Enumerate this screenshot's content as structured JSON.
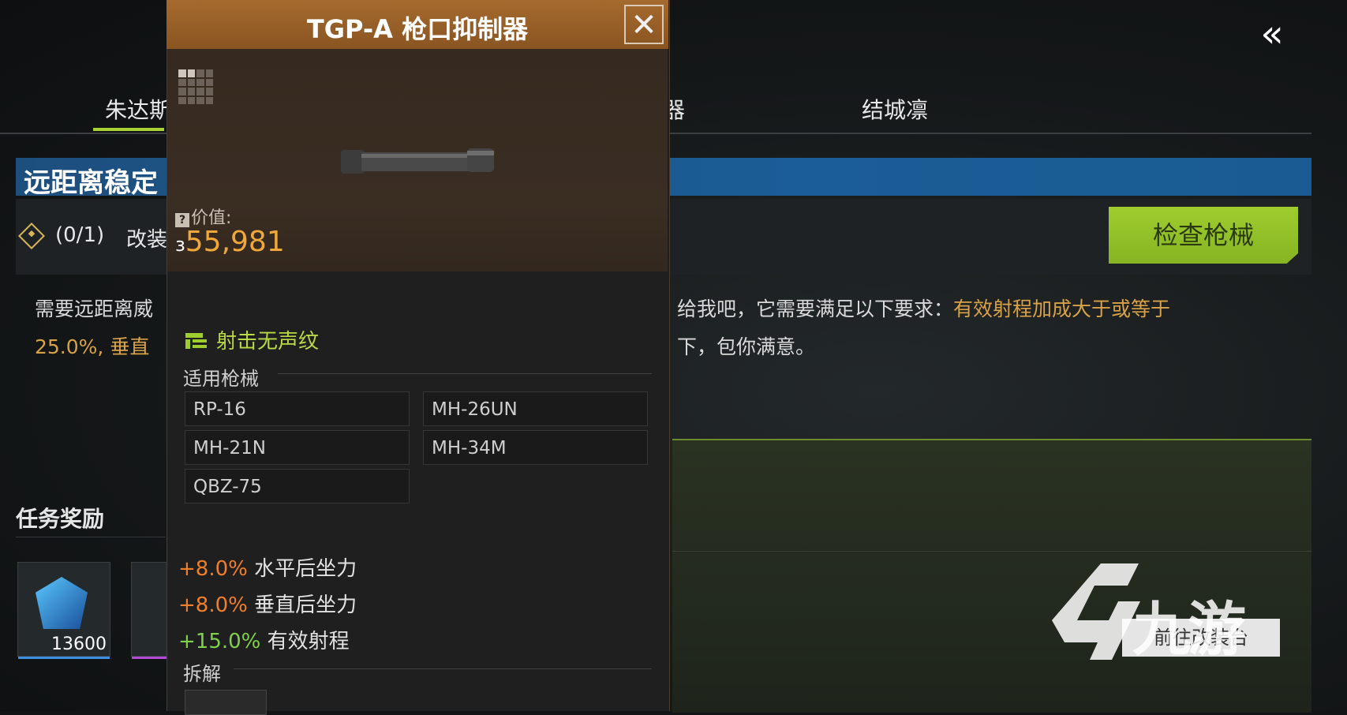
{
  "nav": {
    "back_glyph": "«",
    "tabs": [
      {
        "label": "朱达斯"
      },
      {
        "label": "器"
      },
      {
        "label": "结城凛"
      }
    ]
  },
  "task": {
    "title": "远距离稳定",
    "progress": "(0/1)",
    "objective": "改装",
    "check_button": "检查枪械",
    "desc_left_line1": "需要远距离威",
    "desc_left_line2_highlight": "25.0%, 垂直",
    "desc_right_line1_plain": "给我吧，它需要满足以下要求：",
    "desc_right_line1_highlight": "有效射程加成大于或等于",
    "desc_right_line2": "下，包你满意。",
    "goto_button": "前往改装台"
  },
  "rewards": {
    "title": "任务奖励",
    "items": [
      {
        "count": "13600",
        "icon": "credit-gem-icon"
      },
      {
        "count": "",
        "icon": "gun-part-icon"
      }
    ]
  },
  "popup": {
    "title": "TGP-A 枪口抑制器",
    "close_glyph": "✕",
    "value_label": "价值:",
    "value_currency": "з",
    "value_amount": "55,981",
    "trait": "射击无声纹",
    "applicable_label": "适用枪械",
    "guns": [
      "RP-16",
      "MH-26UN",
      "MH-21N",
      "MH-34M",
      "QBZ-75"
    ],
    "stats": [
      {
        "value": "+8.0%",
        "name": "水平后坐力",
        "tone": "orange"
      },
      {
        "value": "+8.0%",
        "name": "垂直后坐力",
        "tone": "orange"
      },
      {
        "value": "+15.0%",
        "name": "有效射程",
        "tone": "green"
      }
    ],
    "disassemble_label": "拆解"
  },
  "watermark": {
    "text": "九游"
  },
  "colors": {
    "accent_green": "#a9d235",
    "popup_header": "#a56a2e",
    "value_orange": "#f0a83a",
    "task_banner_blue": "#1b5d96",
    "highlight_gold": "#d9a246"
  }
}
